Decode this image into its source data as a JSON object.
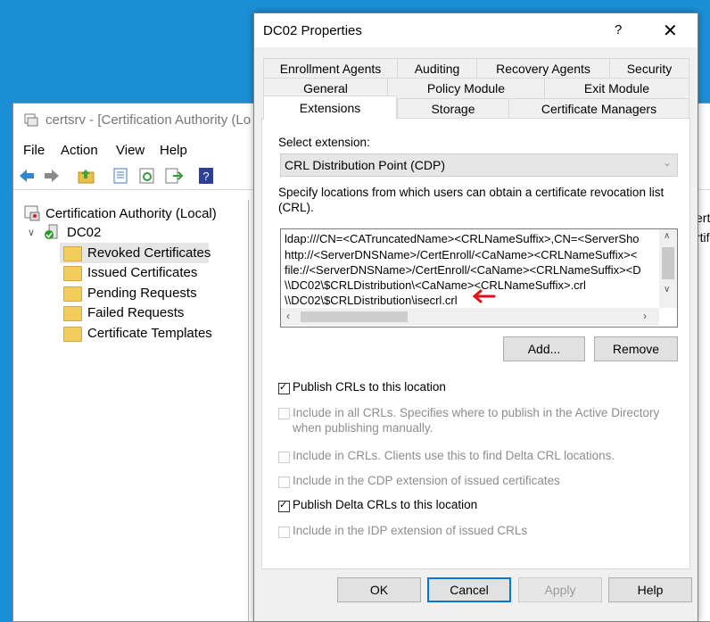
{
  "bg_window": {
    "title": "certsrv - [Certification Authority (Lo",
    "menu": [
      "File",
      "Action",
      "View",
      "Help"
    ],
    "tree": {
      "root": "Certification Authority (Local)",
      "server": "DC02",
      "folders": [
        "Revoked Certificates",
        "Issued Certificates",
        "Pending Requests",
        "Failed Requests",
        "Certificate Templates"
      ]
    },
    "right_fragments": [
      "ertific",
      "rtifi"
    ]
  },
  "dialog": {
    "title": "DC02 Properties",
    "help": "?",
    "close": "✕",
    "tabs_row1": [
      "Enrollment Agents",
      "Auditing",
      "Recovery Agents",
      "Security"
    ],
    "tabs_row2": [
      "General",
      "Policy Module",
      "Exit Module"
    ],
    "tabs_row3": [
      "Extensions",
      "Storage",
      "Certificate Managers"
    ],
    "select_label": "Select extension:",
    "select_value": "CRL Distribution Point (CDP)",
    "description": "Specify locations from which users can obtain a certificate revocation list (CRL).",
    "locations": [
      "ldap:///CN=<CATruncatedName><CRLNameSuffix>,CN=<ServerSho",
      "http://<ServerDNSName>/CertEnroll/<CaName><CRLNameSuffix><",
      "file://<ServerDNSName>/CertEnroll/<CaName><CRLNameSuffix><D",
      "\\\\DC02\\$CRLDistribution\\<CaName><CRLNameSuffix>.crl",
      "\\\\DC02\\$CRLDistribution\\isecrl.crl"
    ],
    "add": "Add...",
    "remove": "Remove",
    "options": [
      {
        "label": "Publish CRLs to this location",
        "checked": true,
        "enabled": true
      },
      {
        "label": "Include in all CRLs. Specifies where to publish in the Active Directory when publishing manually.",
        "checked": false,
        "enabled": false
      },
      {
        "label": "Include in CRLs. Clients use this to find Delta CRL locations.",
        "checked": false,
        "enabled": false
      },
      {
        "label": "Include in the CDP extension of issued certificates",
        "checked": false,
        "enabled": false
      },
      {
        "label": "Publish Delta CRLs to this location",
        "checked": true,
        "enabled": true
      },
      {
        "label": "Include in the IDP extension of issued CRLs",
        "checked": false,
        "enabled": false
      }
    ],
    "ok": "OK",
    "cancel": "Cancel",
    "apply": "Apply",
    "help_btn": "Help",
    "accent": "#0078d7",
    "arrow_color": "#e0101c"
  }
}
